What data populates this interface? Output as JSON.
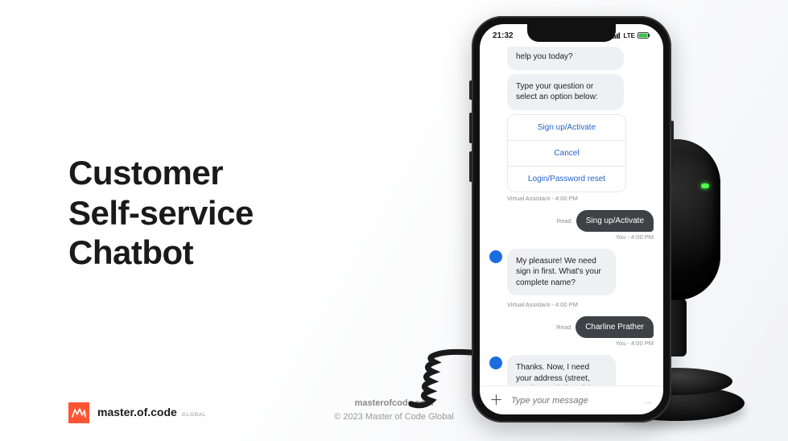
{
  "headline": "Customer\nSelf-service\nChatbot",
  "brand": {
    "name": "master.of.code",
    "sub": "GLOBAL"
  },
  "footer": {
    "site": "masterofcode.com",
    "copyright": "© 2023 Master of Code Global"
  },
  "phone": {
    "time": "21:32",
    "network": "LTE",
    "chat": {
      "greeting_tail": "help you today?",
      "prompt": "Type your question or select an option below:",
      "options": [
        "Sign up/Activate",
        "Cancel",
        "Login/Password reset"
      ],
      "meta_va": "Virtual Assistant - 4:00 PM",
      "read": "Read",
      "user1": "Sing up/Activate",
      "meta_you": "You - 4:00 PM",
      "bot2": "My pleasure! We need sign in first. What's your complete name?",
      "user2": "Charline Prather",
      "bot3": "Thanks. Now, I need your address (street, number and zipcode)"
    },
    "input_placeholder": "Type your message"
  }
}
